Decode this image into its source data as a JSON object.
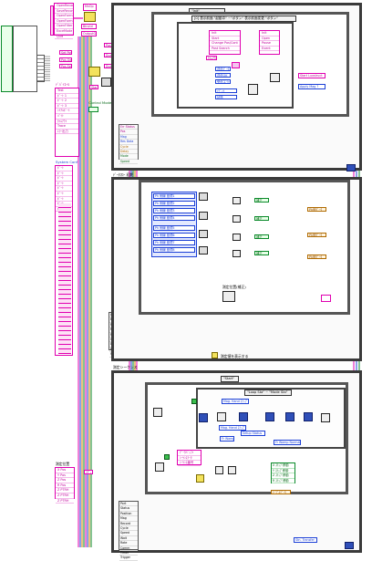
{
  "state_cluster": {
    "items": [
      "OpenRecord",
      "SaveRecord",
      "OpenFormData",
      "OpenFormFilter",
      "OpenFilter",
      "ExceMode",
      "Quit"
    ]
  },
  "main_loop": {
    "case_selector": "\"Init\"",
    "event_selector": "[0] 表示前面 \"起動中\" ~\"ボタン\" 表示前面変更 \"ボタン\"",
    "event_items": [
      "Init",
      "Start",
      "Change Pos/Cont",
      "Post Search"
    ],
    "event_items_right": [
      "Init",
      "Open",
      "Pause",
      "Event"
    ],
    "timeout_label": "ﾀｲﾑｱｳﾄ",
    "ctrl_labels": [
      "送信ﾃﾞｰﾀ",
      "送信OK",
      "受信エラー",
      "ｲﾍﾞﾝﾄ",
      "状態"
    ],
    "right_labels": [
      "Start Luxstruct",
      "Apply Mag ?"
    ]
  },
  "left_panel": {
    "group_title": "ﾃﾞﾊﾞｲｽｰﾙ",
    "items": [
      "Test",
      "ﾎﾟｰﾄ 1",
      "ﾎﾟｰﾄ 2",
      "ﾎﾟｰﾄ 3",
      "ｼﾘｱﾙﾎﾟｰﾄ",
      "ﾊﾞｲﾄ",
      "ﾀｲﾑｱｳﾄ",
      "Trace",
      "ｴﾗｰ出力"
    ],
    "sys_config_title": "System Conf",
    "sys_items": [
      "ﾎﾟｰﾄ",
      "ﾎﾟｰﾄ",
      "ﾎﾟｰﾄ",
      "ﾎﾟｰﾄ",
      "ﾎﾟｰﾄ",
      "ﾎﾟｰﾄ",
      "ﾎﾟｰﾄ",
      "ﾎﾟｰﾄ",
      "ﾎﾟｰﾄ"
    ]
  },
  "second_frame": {
    "title": "ﾃﾞｰﾀﾌﾛｰ 初期",
    "case_selector": "\"Update Status\"",
    "blue_blocks": [
      "Ph 側線 座標1",
      "Ph 側線 座標2",
      "Ph 側線 座標3",
      "Ph 側線 座標4",
      "Ph 側線 座標5",
      "Ph 側線 座標6",
      "Ph 側線 座標7",
      "Ph 側線 座標8"
    ],
    "green_labels": [
      "補正",
      "補正",
      "補正",
      "補正"
    ],
    "right_labels": [
      "Ph側ﾃﾞｰﾀ",
      "Ph側ﾃﾞｰﾀ",
      "Ph側ﾃﾞｰﾀ"
    ],
    "mid_label": "測定位置(補正)",
    "bottom_label": "測定値を表示する"
  },
  "bundle_left": [
    "ﾎﾟｰﾄ",
    "Err Status",
    "Pos",
    "Mag",
    "Res Data",
    "Cycle",
    "Delay",
    "Mode",
    "Speed"
  ],
  "third_frame": {
    "title": "測定シーケンス",
    "case_selector": "\"Start\"",
    "inner_selector": "\"Loop Sta\" ~ \"Mode Sta\"",
    "labels": [
      "Mag. Hand ｽﾃｯﾌﾟ",
      "Mag. Hand ｽﾃｯﾌﾟ",
      "Setup Status",
      "Fr Wamp",
      "Fr Wamp Normal"
    ],
    "pos_title": "測定位置",
    "pos_items": [
      "X Pos",
      "Y Pos",
      "Z Pos",
      "R Pos",
      "Z PTRH",
      "Z PTRH",
      "Z PTRH"
    ],
    "right_stack": [
      "X ｽﾃｯﾌﾟ移動",
      "Y ｽﾃｯﾌﾟ移動",
      "Z ｽﾃｯﾌﾟ移動",
      "R ｽﾃｯﾌﾟ移動"
    ],
    "mid_labels": [
      "ﾃﾞｰﾀﾊﾞｯﾌｧ",
      "ｼｰｹﾝｽﾃｰﾀ",
      "ｼｰｹﾝｽ番号"
    ],
    "right_label": "ﾃｰﾌﾞﾙﾃﾞｰﾀ",
    "bottom_label": "Stn. Transfer",
    "bottom_bundle": [
      "Port",
      "Status",
      "Position",
      "Mag",
      "Record",
      "Cycle",
      "Speed",
      "Wait",
      "Rate",
      "Comm",
      "Timer",
      "Trigger"
    ]
  },
  "misc": {
    "status_boxes": [
      "Set Posi",
      "Pos.Get",
      "Pos.Set",
      "Pos.Got",
      "Dum Fail",
      "Dum Fail",
      "Start",
      "ﾘﾃﾞｨ"
    ],
    "top_icons": [
      "MnOp",
      "Btnctrl",
      "OutputGet"
    ],
    "control_mode": "Control Mode"
  },
  "colors": {
    "pink": "#e000b0",
    "blue": "#1b3fd6",
    "green": "#0a8a2a",
    "orange": "#d08a00",
    "frame": "#3a3a3a"
  }
}
